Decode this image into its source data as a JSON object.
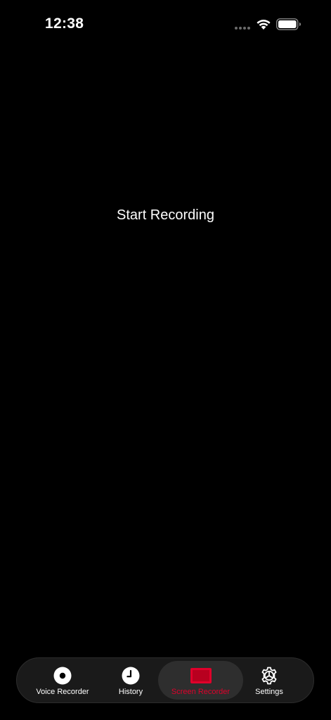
{
  "status_bar": {
    "time": "12:38",
    "wifi_icon": "wifi-icon",
    "battery_icon": "battery-icon"
  },
  "main": {
    "start_recording_label": "Start Recording"
  },
  "tab_bar": {
    "active_tab": "Screen Recorder",
    "active_color": "#e0002b",
    "tabs": [
      {
        "label": "Voice Recorder",
        "icon": "record-icon"
      },
      {
        "label": "History",
        "icon": "clock-icon"
      },
      {
        "label": "Screen Recorder",
        "icon": "screen-icon"
      },
      {
        "label": "Settings",
        "icon": "gear-icon"
      }
    ]
  }
}
